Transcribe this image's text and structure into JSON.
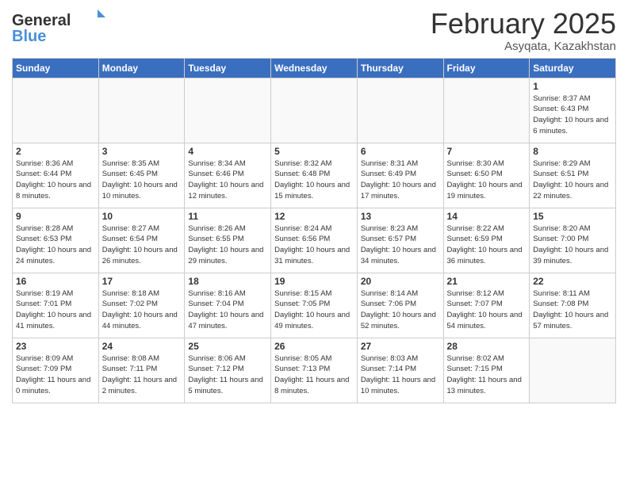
{
  "logo": {
    "line1": "General",
    "line2": "Blue"
  },
  "title": "February 2025",
  "location": "Asyqata, Kazakhstan",
  "days_of_week": [
    "Sunday",
    "Monday",
    "Tuesday",
    "Wednesday",
    "Thursday",
    "Friday",
    "Saturday"
  ],
  "weeks": [
    [
      {
        "day": "",
        "info": ""
      },
      {
        "day": "",
        "info": ""
      },
      {
        "day": "",
        "info": ""
      },
      {
        "day": "",
        "info": ""
      },
      {
        "day": "",
        "info": ""
      },
      {
        "day": "",
        "info": ""
      },
      {
        "day": "1",
        "info": "Sunrise: 8:37 AM\nSunset: 6:43 PM\nDaylight: 10 hours\nand 6 minutes."
      }
    ],
    [
      {
        "day": "2",
        "info": "Sunrise: 8:36 AM\nSunset: 6:44 PM\nDaylight: 10 hours\nand 8 minutes."
      },
      {
        "day": "3",
        "info": "Sunrise: 8:35 AM\nSunset: 6:45 PM\nDaylight: 10 hours\nand 10 minutes."
      },
      {
        "day": "4",
        "info": "Sunrise: 8:34 AM\nSunset: 6:46 PM\nDaylight: 10 hours\nand 12 minutes."
      },
      {
        "day": "5",
        "info": "Sunrise: 8:32 AM\nSunset: 6:48 PM\nDaylight: 10 hours\nand 15 minutes."
      },
      {
        "day": "6",
        "info": "Sunrise: 8:31 AM\nSunset: 6:49 PM\nDaylight: 10 hours\nand 17 minutes."
      },
      {
        "day": "7",
        "info": "Sunrise: 8:30 AM\nSunset: 6:50 PM\nDaylight: 10 hours\nand 19 minutes."
      },
      {
        "day": "8",
        "info": "Sunrise: 8:29 AM\nSunset: 6:51 PM\nDaylight: 10 hours\nand 22 minutes."
      }
    ],
    [
      {
        "day": "9",
        "info": "Sunrise: 8:28 AM\nSunset: 6:53 PM\nDaylight: 10 hours\nand 24 minutes."
      },
      {
        "day": "10",
        "info": "Sunrise: 8:27 AM\nSunset: 6:54 PM\nDaylight: 10 hours\nand 26 minutes."
      },
      {
        "day": "11",
        "info": "Sunrise: 8:26 AM\nSunset: 6:55 PM\nDaylight: 10 hours\nand 29 minutes."
      },
      {
        "day": "12",
        "info": "Sunrise: 8:24 AM\nSunset: 6:56 PM\nDaylight: 10 hours\nand 31 minutes."
      },
      {
        "day": "13",
        "info": "Sunrise: 8:23 AM\nSunset: 6:57 PM\nDaylight: 10 hours\nand 34 minutes."
      },
      {
        "day": "14",
        "info": "Sunrise: 8:22 AM\nSunset: 6:59 PM\nDaylight: 10 hours\nand 36 minutes."
      },
      {
        "day": "15",
        "info": "Sunrise: 8:20 AM\nSunset: 7:00 PM\nDaylight: 10 hours\nand 39 minutes."
      }
    ],
    [
      {
        "day": "16",
        "info": "Sunrise: 8:19 AM\nSunset: 7:01 PM\nDaylight: 10 hours\nand 41 minutes."
      },
      {
        "day": "17",
        "info": "Sunrise: 8:18 AM\nSunset: 7:02 PM\nDaylight: 10 hours\nand 44 minutes."
      },
      {
        "day": "18",
        "info": "Sunrise: 8:16 AM\nSunset: 7:04 PM\nDaylight: 10 hours\nand 47 minutes."
      },
      {
        "day": "19",
        "info": "Sunrise: 8:15 AM\nSunset: 7:05 PM\nDaylight: 10 hours\nand 49 minutes."
      },
      {
        "day": "20",
        "info": "Sunrise: 8:14 AM\nSunset: 7:06 PM\nDaylight: 10 hours\nand 52 minutes."
      },
      {
        "day": "21",
        "info": "Sunrise: 8:12 AM\nSunset: 7:07 PM\nDaylight: 10 hours\nand 54 minutes."
      },
      {
        "day": "22",
        "info": "Sunrise: 8:11 AM\nSunset: 7:08 PM\nDaylight: 10 hours\nand 57 minutes."
      }
    ],
    [
      {
        "day": "23",
        "info": "Sunrise: 8:09 AM\nSunset: 7:09 PM\nDaylight: 11 hours\nand 0 minutes."
      },
      {
        "day": "24",
        "info": "Sunrise: 8:08 AM\nSunset: 7:11 PM\nDaylight: 11 hours\nand 2 minutes."
      },
      {
        "day": "25",
        "info": "Sunrise: 8:06 AM\nSunset: 7:12 PM\nDaylight: 11 hours\nand 5 minutes."
      },
      {
        "day": "26",
        "info": "Sunrise: 8:05 AM\nSunset: 7:13 PM\nDaylight: 11 hours\nand 8 minutes."
      },
      {
        "day": "27",
        "info": "Sunrise: 8:03 AM\nSunset: 7:14 PM\nDaylight: 11 hours\nand 10 minutes."
      },
      {
        "day": "28",
        "info": "Sunrise: 8:02 AM\nSunset: 7:15 PM\nDaylight: 11 hours\nand 13 minutes."
      },
      {
        "day": "",
        "info": ""
      }
    ]
  ]
}
